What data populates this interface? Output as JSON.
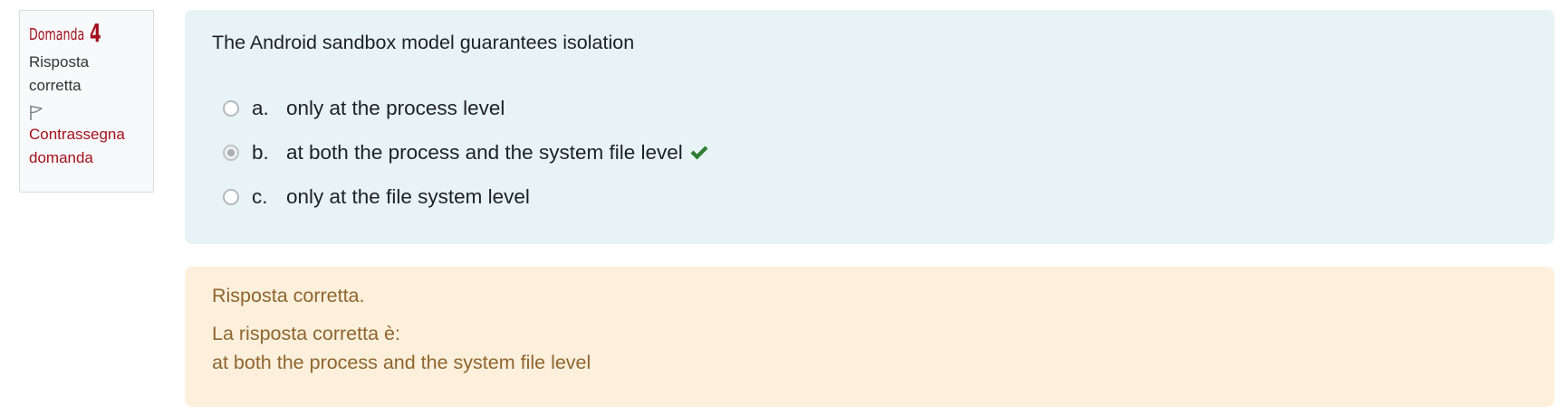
{
  "question_info": {
    "label": "Domanda",
    "number": "4",
    "state": "Risposta corretta",
    "flag_icon": "flag-icon",
    "flag_link": "Contrassegna domanda"
  },
  "question": {
    "text": "The Android sandbox model guarantees isolation",
    "answers": [
      {
        "letter": "a.",
        "text": "only at the process level",
        "selected": false,
        "correct_mark": false
      },
      {
        "letter": "b.",
        "text": "at both the process and the system file level",
        "selected": true,
        "correct_mark": true
      },
      {
        "letter": "c.",
        "text": "only at the file system level",
        "selected": false,
        "correct_mark": false
      }
    ],
    "correct_icon": "check-icon",
    "correct_color": "#2e7d32"
  },
  "feedback": {
    "status": "Risposta corretta.",
    "right_answer_label": "La risposta corretta è:",
    "right_answer": "at both the process and the system file level"
  },
  "colors": {
    "brand_red": "#a3111c",
    "formulation_bg": "#e7f3f5",
    "feedback_bg": "#fcefdc",
    "feedback_text": "#8e662e"
  }
}
